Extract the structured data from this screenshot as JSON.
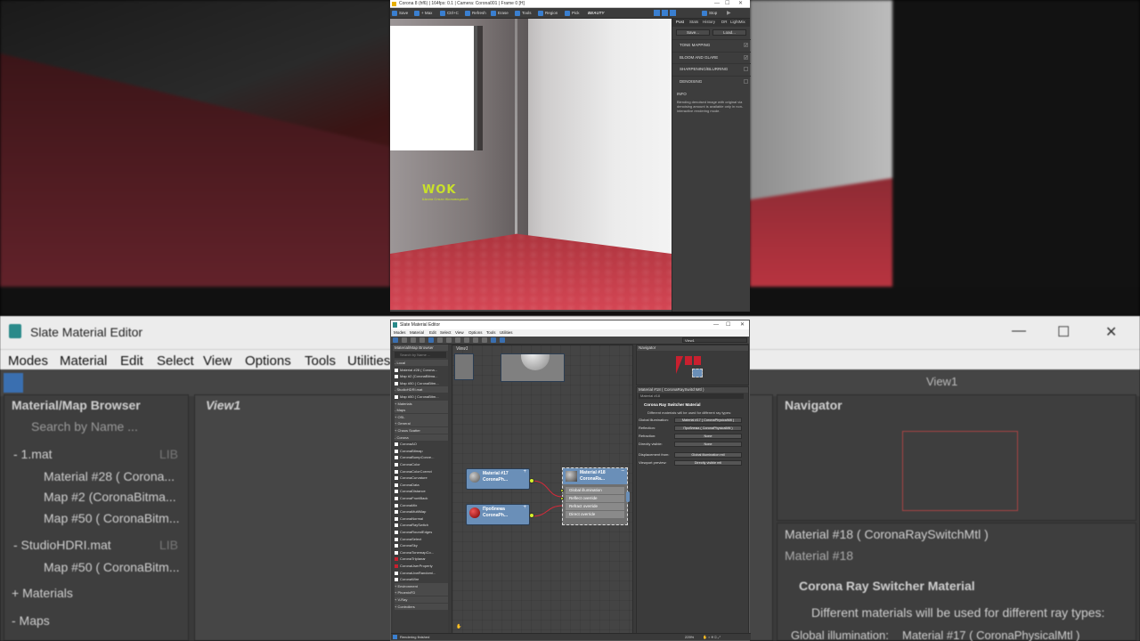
{
  "colors": {
    "accent": "#3a7fd0",
    "node_header": "#6a8fb8",
    "logo": "#c9e12a",
    "wire": "#d62a3a",
    "slot_dot": "#d8f02a"
  },
  "vfb": {
    "title": "Corona 8 (hf6) | 164fps: 0.1 | Camera: Corona001 | Frame 0 [H]",
    "toolbar": [
      "Save",
      "+ Max",
      "Ctrl+C",
      "Refresh",
      "Erase",
      "Tools",
      "Region",
      "Pick",
      "BEAUTY"
    ],
    "stop_label": "Stop",
    "post_tabs": [
      "Post",
      "Stats",
      "History",
      "DR",
      "LightMix"
    ],
    "save_btn": "Save...",
    "load_btn": "Load...",
    "sections": [
      {
        "label": "TONE MAPPING",
        "checked": "✓"
      },
      {
        "label": "BLOOM AND GLARE",
        "checked": "✓"
      },
      {
        "label": "SHARPENING/BLURRING",
        "checked": ""
      },
      {
        "label": "DENOISING",
        "checked": ""
      }
    ],
    "info_title": "INFO",
    "info_text": "Blending denoised image with original via denoising amount is available only in non-interactive rendering mode.",
    "logo_mark": "WOK",
    "logo_sub": "Школа Ольги Жиловициной"
  },
  "sme": {
    "title": "Slate Material Editor",
    "menu": [
      "Modes",
      "Material",
      "Edit",
      "Select",
      "View",
      "Options",
      "Tools",
      "Utilities"
    ],
    "browser_title": "Material/Map Browser",
    "search_placeholder": "Search by Name ...",
    "browser_rows": [
      {
        "label": "- Local",
        "grp": true
      },
      {
        "label": "Material #28 ( Corona...",
        "grp": false
      },
      {
        "label": "Map #2 (CoronaBitma...",
        "grp": false
      },
      {
        "label": "Map #50 ( CoronaBitm...",
        "grp": false
      },
      {
        "label": "- StudioHDRI.mat",
        "grp": true
      },
      {
        "label": "Map #50 ( CoronaBitm...",
        "grp": false
      },
      {
        "label": "+ Materials",
        "grp": true
      },
      {
        "label": "- Maps",
        "grp": true
      },
      {
        "label": "+ OSL",
        "grp": true
      },
      {
        "label": "+ General",
        "grp": true
      },
      {
        "label": "+ Chaos Scatter",
        "grp": true
      },
      {
        "label": "- Corona",
        "grp": true
      },
      {
        "label": "CoronaAO",
        "grp": false
      },
      {
        "label": "CoronaBitmap",
        "grp": false
      },
      {
        "label": "CoronaBumpConve...",
        "grp": false
      },
      {
        "label": "CoronaColor",
        "grp": false
      },
      {
        "label": "CoronaColorCorrect",
        "grp": false
      },
      {
        "label": "CoronaCurvature",
        "grp": false
      },
      {
        "label": "CoronaData",
        "grp": false
      },
      {
        "label": "CoronaDistance",
        "grp": false
      },
      {
        "label": "CoronaFrontBack",
        "grp": false
      },
      {
        "label": "CoronaMix",
        "grp": false
      },
      {
        "label": "CoronaMultiMap",
        "grp": false
      },
      {
        "label": "CoronaNormal",
        "grp": false
      },
      {
        "label": "CoronaRaySwitch",
        "grp": false
      },
      {
        "label": "CoronaRoundEdges",
        "grp": false
      },
      {
        "label": "CoronaSelect",
        "grp": false
      },
      {
        "label": "CoronaSky",
        "grp": false
      },
      {
        "label": "CoronaTonemapCo...",
        "grp": false
      },
      {
        "label": "CoronaTriplanar",
        "grp": false
      },
      {
        "label": "CoronaUserProperty",
        "grp": false
      },
      {
        "label": "CoronaUvwRandomi...",
        "grp": false
      },
      {
        "label": "CoronaWire",
        "grp": false
      },
      {
        "label": "+ Environment",
        "grp": true
      },
      {
        "label": "+ PhoenixFD",
        "grp": true
      },
      {
        "label": "+ V-Ray",
        "grp": true
      },
      {
        "label": "+ Controllers",
        "grp": true
      }
    ],
    "view_tab": "View1",
    "view_dropdown": "View1",
    "nodes": {
      "mat17": {
        "line1": "Material #17",
        "line2": "CoronaPh..."
      },
      "problem": {
        "line1": "Проблема",
        "line2": "CoronaPh..."
      },
      "mat18": {
        "line1": "Material #18",
        "line2": "CoronaRa..."
      }
    },
    "slots": [
      "Global illumination",
      "Reflect override",
      "Refract override",
      "Direct override"
    ],
    "navigator_title": "Navigator",
    "props_title": "Material #18 ( CoronaRaySwitchMtl )",
    "props_name": "Material #18",
    "rollout_title": "Corona Ray Switcher Material",
    "rollout_desc": "Different materials will be used for different ray types:",
    "props": [
      {
        "label": "Global illumination:",
        "value": "Material #17 ( CoronaPhysicalMtl )"
      },
      {
        "label": "Reflection:",
        "value": "Проблема ( CoronaPhysicalMtl )"
      },
      {
        "label": "Refraction:",
        "value": "None"
      },
      {
        "label": "Directly visible:",
        "value": "None"
      },
      {
        "label": "Displacement from:",
        "value": "Global illumination mtl"
      },
      {
        "label": "Viewport preview:",
        "value": "Directly visible mtl"
      }
    ],
    "status": "Rendering finished",
    "zoom": "225%"
  },
  "background": {
    "title": "Slate Material Editor",
    "menu": [
      "Modes",
      "Material",
      "Edit",
      "Select",
      "View",
      "Options",
      "Tools",
      "Utilities"
    ],
    "browser_title": "Material/Map Browser",
    "search": "Search by Name ...",
    "rows": [
      "- 1.mat",
      "Material #28 ( Corona...",
      "Map #2 (CoronaBitma...",
      "Map #50 ( CoronaBitm...",
      "- StudioHDRI.mat",
      "Map #50 ( CoronaBitm...",
      "+ Materials",
      "- Maps"
    ],
    "lib": "LIB",
    "view_tab": "View1",
    "view_dropdown": "View1",
    "navigator": "Navigator",
    "props_title": "Material #18 ( CoronaRaySwitchMtl )",
    "props_name": "Material #18",
    "rollout": "Corona Ray Switcher Material",
    "desc": "Different materials will be used for different ray types:",
    "gi_label": "Global illumination:",
    "gi_value": "Material #17 ( CoronaPhysicalMtl )"
  }
}
